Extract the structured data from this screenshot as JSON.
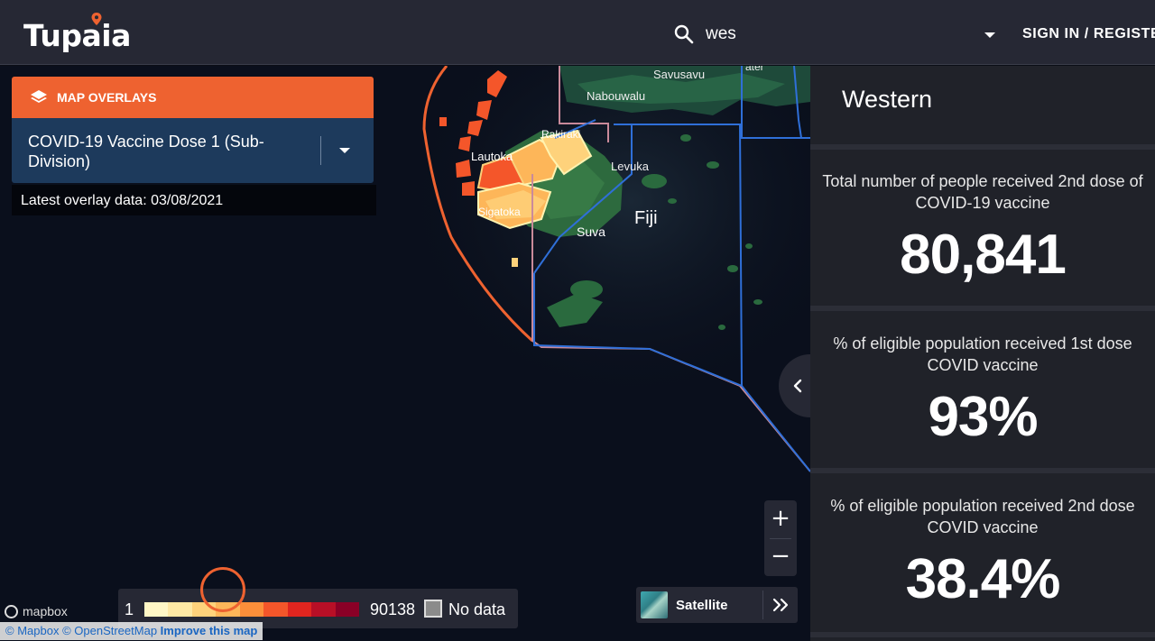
{
  "header": {
    "logo_text": "Tupaia",
    "search_value": "wes",
    "signin_label": "SIGN IN / REGISTER"
  },
  "map_overlays": {
    "title": "MAP OVERLAYS",
    "selected": "COVID-19 Vaccine Dose 1 (Sub-Division)",
    "latest_data": "Latest overlay data: 03/08/2021"
  },
  "map_labels": {
    "savusavu": "Savusavu",
    "nabouwalu": "Nabouwalu",
    "rakiraki": "Rakiraki",
    "lautoka": "Lautoka",
    "levuka": "Levuka",
    "fiji": "Fiji",
    "sigatoka": "Sigatoka",
    "suva": "Suva",
    "partial": "ater"
  },
  "legend": {
    "min": "1",
    "max": "90138",
    "no_data": "No data",
    "colors": [
      "#fff7c6",
      "#fee9a5",
      "#fed27b",
      "#fdb659",
      "#fc8f3a",
      "#f4562a",
      "#e0251f",
      "#b80f26",
      "#8a0026"
    ]
  },
  "basemap": {
    "label": "Satellite"
  },
  "zoom": {
    "in": "+",
    "out": "−"
  },
  "attribution": {
    "logo": "mapbox",
    "mapbox": "© Mapbox",
    "osm": "© OpenStreetMap",
    "improve": "Improve this map"
  },
  "sidebar": {
    "title": "Western",
    "cards": [
      {
        "description": "Total number of people received 2nd dose of COVID-19 vaccine",
        "value": "80,841"
      },
      {
        "description": "% of eligible population received 1st dose COVID vaccine",
        "value": "93%"
      },
      {
        "description": "% of eligible population received 2nd dose COVID vaccine",
        "value": "38.4%"
      }
    ]
  },
  "colors": {
    "accent": "#ee6230",
    "header_bg": "#262834",
    "panel_blue": "#1d3a5c",
    "sidebar_bg": "#202229"
  }
}
